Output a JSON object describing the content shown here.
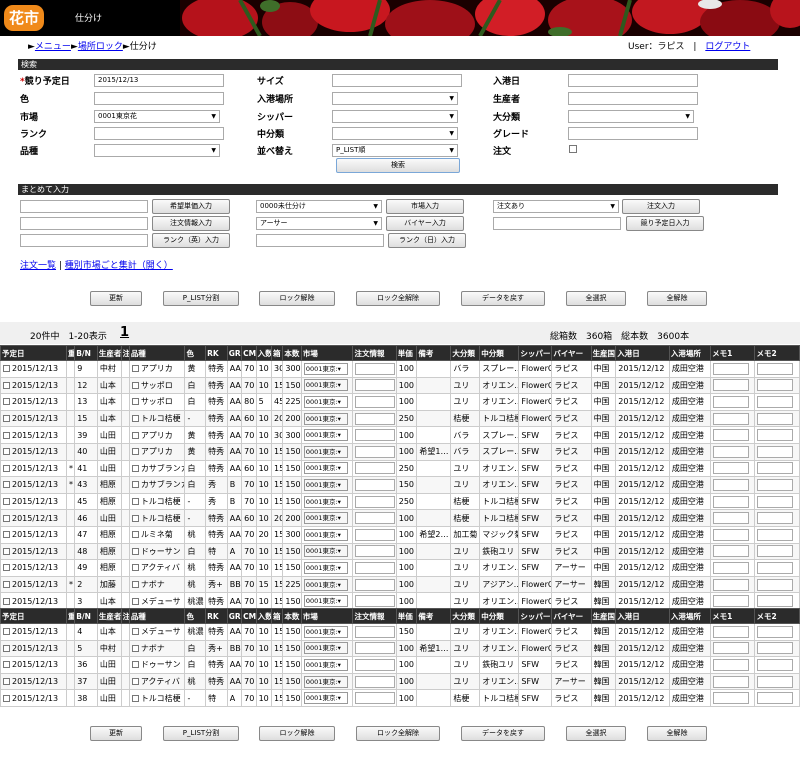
{
  "header": {
    "logo": "花市",
    "title": "仕分け"
  },
  "breadcrumb": {
    "menu": "メニュー",
    "lock": "場所ロック",
    "current": "仕分け"
  },
  "user": {
    "label": "User：ラピス",
    "sep": "|",
    "logout": "ログアウト"
  },
  "search": {
    "section": "検索",
    "fields": {
      "date_label": "競り予定日",
      "date_value": "2015/12/13",
      "size_label": "サイズ",
      "arrive_label": "入港日",
      "color_label": "色",
      "place_label": "入港場所",
      "producer_label": "生産者",
      "market_label": "市場",
      "market_value": "0001東京花",
      "shipper_label": "シッパー",
      "major_label": "大分類",
      "rank_label": "ランク",
      "middle_label": "中分類",
      "grade_label": "グレード",
      "kind_label": "品種",
      "sort_label": "並べ替え",
      "sort_value": "P_LIST順",
      "order_label": "注文"
    },
    "search_button": "検索"
  },
  "bulk": {
    "section": "まとめて入力",
    "wish_price_button": "希望単価入力",
    "order_info_button": "注文情報入力",
    "rank_en_button": "ランク（英）入力",
    "status_select": "0000未仕分け",
    "market_button": "市場入力",
    "buyer_select": "アーサー",
    "buyer_button": "バイヤー入力",
    "rank_jp_button": "ランク（日）入力",
    "order_select": "注文あり",
    "order_button": "注文入力",
    "auction_date_button": "競り予定日入力"
  },
  "links": {
    "order_list": "注文一覧",
    "summary": "種別市場ごと集計（開く）"
  },
  "actions": {
    "update": "更新",
    "plist_split": "P_LIST分割",
    "unlock": "ロック解除",
    "unlock_all": "ロック全解除",
    "revert": "データを戻す",
    "select_all": "全選択",
    "clear_all": "全解除"
  },
  "paging": {
    "count": "20件中　1-20表示",
    "page": "1",
    "summary": "総箱数　360箱　総本数　3600本"
  },
  "columns": [
    "予定日",
    "重",
    "B/N",
    "生産者",
    "注",
    "品種",
    "色",
    "RK",
    "GR",
    "CM",
    "入数",
    "箱",
    "本数",
    "市場",
    "注文情報",
    "単価",
    "備考",
    "大分類",
    "中分類",
    "シッパー",
    "バイヤー",
    "生産国",
    "入港日",
    "入港場所",
    "メモ1",
    "メモ2"
  ],
  "rows_top": [
    [
      "2015/12/13",
      "",
      "9",
      "中村",
      "",
      "アプリカ",
      "黄",
      "特秀",
      "AA",
      "70",
      "10",
      "30",
      "300",
      "0001東京:",
      "",
      "100",
      "",
      "バラ",
      "スプレー…",
      "FlowerC",
      "ラピス",
      "中国",
      "2015/12/12",
      "成田空港",
      "",
      ""
    ],
    [
      "2015/12/13",
      "",
      "12",
      "山本",
      "",
      "サッポロ",
      "白",
      "特秀",
      "AA",
      "70",
      "10",
      "15",
      "150",
      "0001東京:",
      "",
      "100",
      "",
      "ユリ",
      "オリエン…",
      "FlowerC",
      "ラピス",
      "中国",
      "2015/12/12",
      "成田空港",
      "",
      ""
    ],
    [
      "2015/12/13",
      "",
      "13",
      "山本",
      "",
      "サッポロ",
      "白",
      "特秀",
      "AA",
      "80",
      "5",
      "45",
      "225",
      "0001東京:",
      "",
      "100",
      "",
      "ユリ",
      "オリエン…",
      "FlowerC",
      "ラピス",
      "中国",
      "2015/12/12",
      "成田空港",
      "",
      ""
    ],
    [
      "2015/12/13",
      "",
      "15",
      "山本",
      "",
      "トルコ桔梗",
      "-",
      "特秀",
      "AA",
      "60",
      "10",
      "20",
      "200",
      "0001東京:",
      "",
      "250",
      "",
      "桔梗",
      "トルコ桔梗",
      "FlowerC",
      "ラピス",
      "中国",
      "2015/12/12",
      "成田空港",
      "",
      ""
    ],
    [
      "2015/12/13",
      "",
      "39",
      "山田",
      "",
      "アプリカ",
      "黄",
      "特秀",
      "AA",
      "70",
      "10",
      "30",
      "300",
      "0001東京:",
      "",
      "100",
      "",
      "バラ",
      "スプレー…",
      "SFW",
      "ラピス",
      "中国",
      "2015/12/12",
      "成田空港",
      "",
      ""
    ],
    [
      "2015/12/13",
      "",
      "40",
      "山田",
      "",
      "アプリカ",
      "黄",
      "特秀",
      "AA",
      "70",
      "10",
      "15",
      "150",
      "0001東京:",
      "",
      "100",
      "希望1…",
      "バラ",
      "スプレー…",
      "SFW",
      "ラピス",
      "中国",
      "2015/12/12",
      "成田空港",
      "",
      ""
    ],
    [
      "2015/12/13",
      "*",
      "41",
      "山田",
      "",
      "カサブランカ",
      "白",
      "特秀",
      "AA",
      "60",
      "10",
      "15",
      "150",
      "0001東京:",
      "",
      "250",
      "",
      "ユリ",
      "オリエン…",
      "SFW",
      "ラピス",
      "中国",
      "2015/12/12",
      "成田空港",
      "",
      ""
    ],
    [
      "2015/12/13",
      "*",
      "43",
      "相原",
      "",
      "カサブランカ",
      "白",
      "秀",
      "B",
      "70",
      "10",
      "15",
      "150",
      "0001東京:",
      "",
      "150",
      "",
      "ユリ",
      "オリエン…",
      "SFW",
      "ラピス",
      "中国",
      "2015/12/12",
      "成田空港",
      "",
      ""
    ],
    [
      "2015/12/13",
      "",
      "45",
      "相原",
      "",
      "トルコ桔梗",
      "-",
      "秀",
      "B",
      "70",
      "10",
      "15",
      "150",
      "0001東京:",
      "",
      "250",
      "",
      "桔梗",
      "トルコ桔梗",
      "SFW",
      "ラピス",
      "中国",
      "2015/12/12",
      "成田空港",
      "",
      ""
    ],
    [
      "2015/12/13",
      "",
      "46",
      "山田",
      "",
      "トルコ桔梗",
      "-",
      "特秀",
      "AA",
      "60",
      "10",
      "20",
      "200",
      "0001東京:",
      "",
      "100",
      "",
      "桔梗",
      "トルコ桔梗",
      "SFW",
      "ラピス",
      "中国",
      "2015/12/12",
      "成田空港",
      "",
      ""
    ],
    [
      "2015/12/13",
      "",
      "47",
      "相原",
      "",
      "ルミネ菊",
      "桃",
      "特秀",
      "AA",
      "70",
      "20",
      "15",
      "300",
      "0001東京:",
      "",
      "100",
      "希望2…",
      "加工菊",
      "マジック菊",
      "SFW",
      "ラピス",
      "中国",
      "2015/12/12",
      "成田空港",
      "",
      ""
    ],
    [
      "2015/12/13",
      "",
      "48",
      "相原",
      "",
      "ドゥーサン",
      "白",
      "特",
      "A",
      "70",
      "10",
      "15",
      "150",
      "0001東京:",
      "",
      "100",
      "",
      "ユリ",
      "鉄砲ユリ",
      "SFW",
      "ラピス",
      "中国",
      "2015/12/12",
      "成田空港",
      "",
      ""
    ],
    [
      "2015/12/13",
      "",
      "49",
      "相原",
      "",
      "アクティバ",
      "桃",
      "特秀",
      "AA",
      "70",
      "10",
      "15",
      "150",
      "0001東京:",
      "",
      "100",
      "",
      "ユリ",
      "オリエン…",
      "SFW",
      "アーサー",
      "中国",
      "2015/12/12",
      "成田空港",
      "",
      ""
    ],
    [
      "2015/12/13",
      "*",
      "2",
      "加藤",
      "",
      "ナボナ",
      "桃",
      "秀+",
      "BB",
      "70",
      "15",
      "15",
      "225",
      "0001東京:",
      "",
      "100",
      "",
      "ユリ",
      "アジアン…",
      "FlowerC",
      "アーサー",
      "韓国",
      "2015/12/12",
      "成田空港",
      "",
      ""
    ],
    [
      "2015/12/13",
      "",
      "3",
      "山本",
      "",
      "メデューサ",
      "桃濃",
      "特秀",
      "AA",
      "70",
      "10",
      "15",
      "150",
      "0001東京:",
      "",
      "100",
      "",
      "ユリ",
      "オリエン…",
      "FlowerC",
      "ラピス",
      "韓国",
      "2015/12/12",
      "成田空港",
      "",
      ""
    ]
  ],
  "rows_bottom": [
    [
      "2015/12/13",
      "",
      "4",
      "山本",
      "",
      "メデューサ",
      "桃濃",
      "特秀",
      "AA",
      "70",
      "10",
      "15",
      "150",
      "0001東京:",
      "",
      "150",
      "",
      "ユリ",
      "オリエン…",
      "FlowerC",
      "ラピス",
      "韓国",
      "2015/12/12",
      "成田空港",
      "",
      ""
    ],
    [
      "2015/12/13",
      "",
      "5",
      "中村",
      "",
      "ナボナ",
      "白",
      "秀+",
      "BB",
      "70",
      "10",
      "15",
      "150",
      "0001東京:",
      "",
      "100",
      "希望1…",
      "ユリ",
      "オリエン…",
      "FlowerC",
      "ラピス",
      "韓国",
      "2015/12/12",
      "成田空港",
      "",
      ""
    ],
    [
      "2015/12/13",
      "",
      "36",
      "山田",
      "",
      "ドゥーサン",
      "白",
      "特秀",
      "AA",
      "70",
      "10",
      "15",
      "150",
      "0001東京:",
      "",
      "100",
      "",
      "ユリ",
      "鉄砲ユリ",
      "SFW",
      "ラピス",
      "韓国",
      "2015/12/12",
      "成田空港",
      "",
      ""
    ],
    [
      "2015/12/13",
      "",
      "37",
      "山田",
      "",
      "アクティバ",
      "桃",
      "特秀",
      "AA",
      "70",
      "10",
      "15",
      "150",
      "0001東京:",
      "",
      "100",
      "",
      "ユリ",
      "オリエン…",
      "SFW",
      "アーサー",
      "韓国",
      "2015/12/12",
      "成田空港",
      "",
      ""
    ],
    [
      "2015/12/13",
      "",
      "38",
      "山田",
      "",
      "トルコ桔梗",
      "-",
      "特",
      "A",
      "70",
      "10",
      "15",
      "150",
      "0001東京:",
      "",
      "100",
      "",
      "桔梗",
      "トルコ桔梗",
      "SFW",
      "ラピス",
      "韓国",
      "2015/12/12",
      "成田空港",
      "",
      ""
    ]
  ],
  "colors": {
    "header_bg": "#000000",
    "bar_bg": "#2b2b2b",
    "logo": "#f08a1a",
    "link": "#0000ee",
    "required": "#cc0000"
  }
}
